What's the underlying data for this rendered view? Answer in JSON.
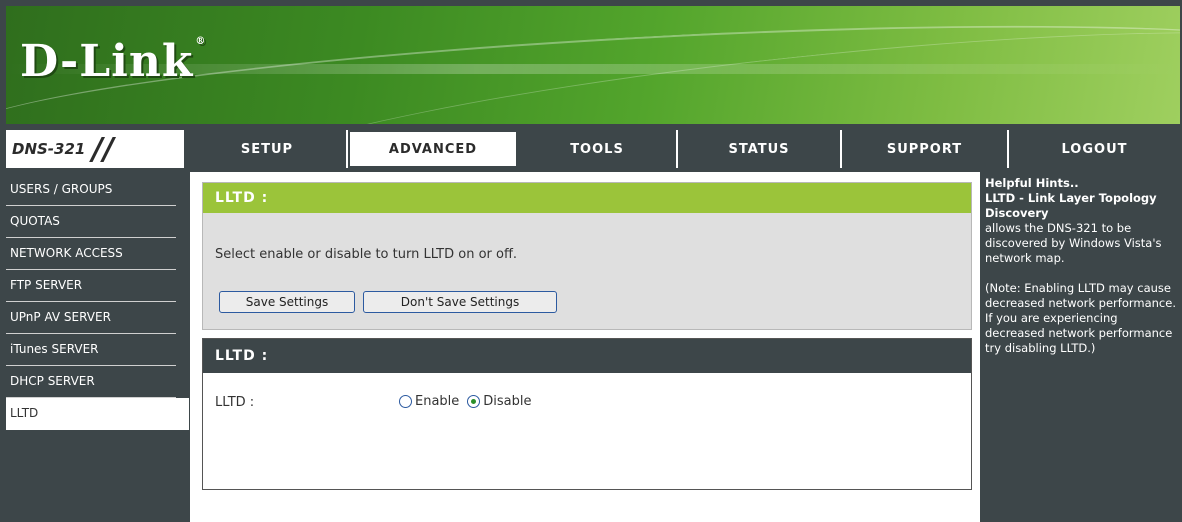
{
  "header": {
    "logo": "D-Link",
    "logo_mark": "®"
  },
  "nav": {
    "model": "DNS-321",
    "tabs": [
      {
        "label": "SETUP"
      },
      {
        "label": "ADVANCED"
      },
      {
        "label": "TOOLS"
      },
      {
        "label": "STATUS"
      },
      {
        "label": "SUPPORT"
      },
      {
        "label": "LOGOUT"
      }
    ],
    "active_tab": "ADVANCED"
  },
  "sidebar": {
    "items": [
      {
        "label": "USERS / GROUPS"
      },
      {
        "label": "QUOTAS"
      },
      {
        "label": "NETWORK ACCESS"
      },
      {
        "label": "FTP SERVER"
      },
      {
        "label": "UPnP AV SERVER"
      },
      {
        "label": "iTunes SERVER"
      },
      {
        "label": "DHCP SERVER"
      },
      {
        "label": "LLTD"
      }
    ],
    "active_item": "LLTD"
  },
  "main": {
    "section1": {
      "title": "LLTD :",
      "description": "Select enable or disable to turn LLTD on or off.",
      "save_label": "Save Settings",
      "dont_save_label": "Don't Save Settings"
    },
    "section2": {
      "title": "LLTD :",
      "field_label": "LLTD :",
      "enable_label": "Enable",
      "disable_label": "Disable",
      "selected": "Disable"
    }
  },
  "hints": {
    "heading": "Helpful Hints..",
    "subheading": "LLTD - Link Layer Topology Discovery",
    "body": "allows the DNS-321 to be discovered by Windows Vista's network map.",
    "note": "(Note: Enabling LLTD may cause decreased network performance. If you are experiencing decreased network performance try disabling LLTD.)"
  },
  "colors": {
    "dark": "#3d4649",
    "green_title": "#9bc43a",
    "header_green": "#3c8a22"
  }
}
